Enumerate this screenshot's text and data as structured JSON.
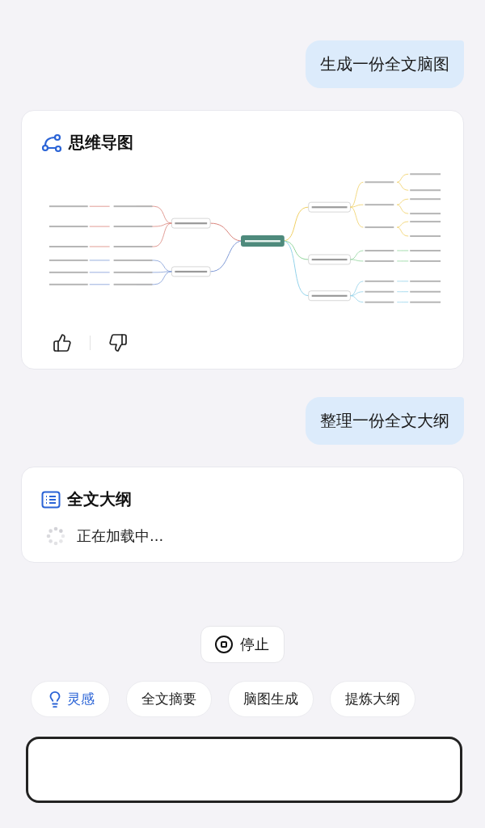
{
  "messages": [
    {
      "kind": "user",
      "text": "生成一份全文脑图"
    },
    {
      "kind": "mindmap",
      "title": "思维导图",
      "diagram": {
        "kind": "picture"
      }
    },
    {
      "kind": "user",
      "text": "整理一份全文大纲"
    },
    {
      "kind": "outline",
      "title": "全文大纲",
      "status": "正在加载中..."
    }
  ],
  "stop_button": {
    "label": "停止"
  },
  "chips": [
    {
      "label": "灵感",
      "kind": "accent"
    },
    {
      "label": "全文摘要",
      "kind": "plain"
    },
    {
      "label": "脑图生成",
      "kind": "plain"
    },
    {
      "label": "提炼大纲",
      "kind": "plain"
    }
  ]
}
